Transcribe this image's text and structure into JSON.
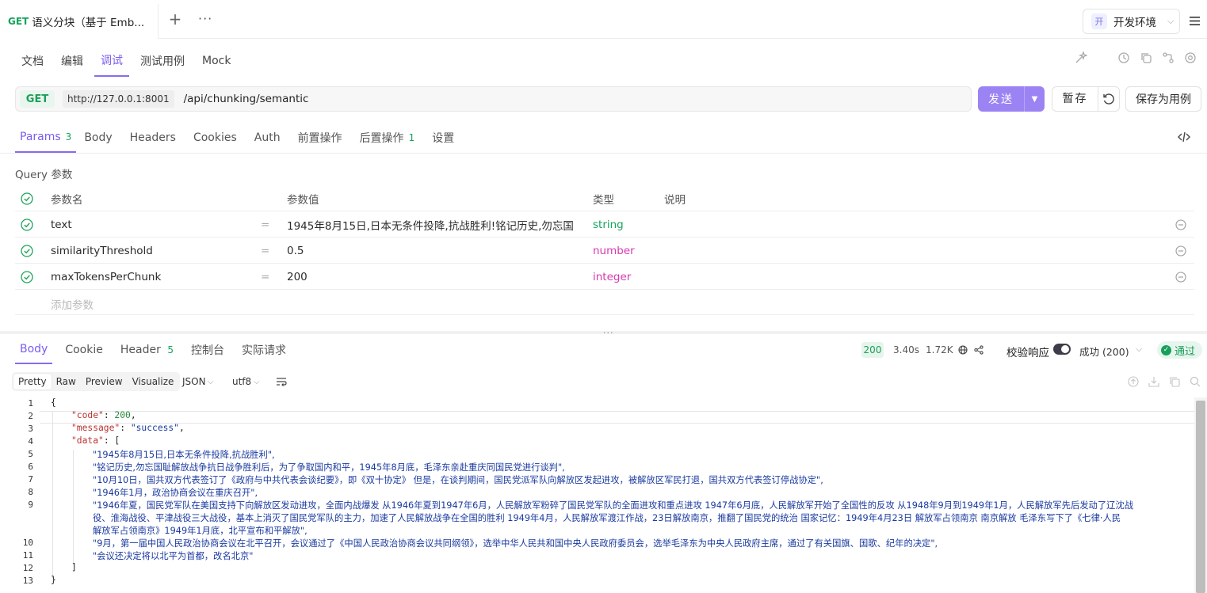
{
  "tabbar": {
    "tab_method": "GET",
    "tab_title": "语义分块（基于 Emb...",
    "add": "+",
    "more": "···",
    "env_badge": "开",
    "env_label": "开发环境",
    "env_chevron": "⌵"
  },
  "subnav": [
    "文档",
    "编辑",
    "调试",
    "测试用例",
    "Mock"
  ],
  "request": {
    "method": "GET",
    "base_url": "http://127.0.0.1:8001",
    "path": "/api/chunking/semantic",
    "send": "发送",
    "send_arrow": "▼",
    "save_temp": "暂存",
    "save_case": "保存为用例"
  },
  "req_tabs": {
    "params": "Params",
    "params_count": "3",
    "body": "Body",
    "headers": "Headers",
    "cookies": "Cookies",
    "auth": "Auth",
    "pre": "前置操作",
    "post": "后置操作",
    "post_count": "1",
    "settings": "设置"
  },
  "query": {
    "title": "Query 参数",
    "headers": {
      "name": "参数名",
      "value": "参数值",
      "type": "类型",
      "desc": "说明"
    },
    "rows": [
      {
        "name": "text",
        "eq": "=",
        "value": "1945年8月15日,日本无条件投降,抗战胜利!铭记历史,勿忘国",
        "type": "string"
      },
      {
        "name": "similarityThreshold",
        "eq": "=",
        "value": "0.5",
        "type": "number"
      },
      {
        "name": "maxTokensPerChunk",
        "eq": "=",
        "value": "200",
        "type": "integer"
      }
    ],
    "add_placeholder": "添加参数"
  },
  "divider_dots": "···",
  "response": {
    "tabs": {
      "body": "Body",
      "cookie": "Cookie",
      "header": "Header",
      "header_count": "5",
      "console": "控制台",
      "actual": "实际请求"
    },
    "status": "200",
    "time": "3.40s",
    "size": "1.72K",
    "validate": "校验响应",
    "success": "成功 (200)",
    "success_chevron": "⌵",
    "pass": "通过",
    "pass_check": "✓",
    "view_modes": [
      "Pretty",
      "Raw",
      "Preview",
      "Visualize"
    ],
    "format": "JSON",
    "format_chevron": "⌵",
    "encoding": "utf8",
    "encoding_chevron": "⌵"
  },
  "code": {
    "line_numbers": [
      "1",
      "2",
      "3",
      "4",
      "5",
      "6",
      "7",
      "8",
      "9",
      "",
      "",
      "10",
      "11",
      "12",
      "13"
    ],
    "open_brace": "{",
    "code_key": "\"code\"",
    "code_val": "200",
    "message_key": "\"message\"",
    "message_val": "\"success\"",
    "data_key": "\"data\"",
    "data_open": "[",
    "items": [
      "\"1945年8月15日,日本无条件投降,抗战胜利\",",
      "\"铭记历史,勿忘国耻解放战争抗日战争胜利后，为了争取国内和平，1945年8月底，毛泽东亲赴重庆同国民党进行谈判\",",
      "\"10月10日，国共双方代表签订了《政府与中共代表会谈纪要》，即《双十协定》 但是，在谈判期间，国民党派军队向解放区发起进攻，被解放区军民打退，国共双方代表签订停战协定\",",
      "\"1946年1月，政治协商会议在重庆召开\",",
      "\"1946年夏，国民党军队在美国支持下向解放区发动进攻，全面内战爆发  从1946年夏到1947年6月，人民解放军粉碎了国民党军队的全面进攻和重点进攻  1947年6月底，人民解放军开始了全国性的反攻  从1948年9月到1949年1月，人民解放军先后发动了辽沈战",
      "役、淮海战役、平津战役三大战役，基本上消灭了国民党军队的主力，加速了人民解放战争在全国的胜利  1949年4月，人民解放军渡江作战，23日解放南京，推翻了国民党的统治  国家记忆：1949年4月23日  解放军占领南京  南京解放  毛泽东写下了《七律·人民",
      "解放军占领南京》1949年1月底，北平宣布和平解放\",",
      "\"9月，第一届中国人民政治协商会议在北平召开，会议通过了《中国人民政治协商会议共同纲领》，选举中华人民共和国中央人民政府委员会，选举毛泽东为中央人民政府主席，通过了有关国旗、国歌、纪年的决定\",",
      "\"会议还决定将以北平为首都，改名北京\""
    ],
    "data_close": "]",
    "close_brace": "}"
  }
}
